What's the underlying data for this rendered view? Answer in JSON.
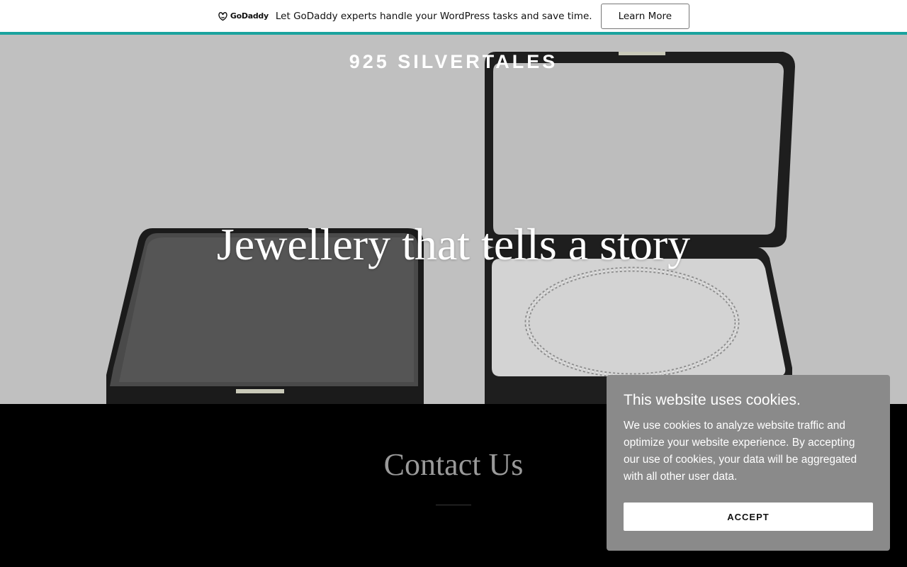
{
  "promo": {
    "logo_text": "GoDaddy",
    "message": "Let GoDaddy experts handle your WordPress tasks and save time.",
    "button_label": "Learn More",
    "accent_color": "#1aa39e"
  },
  "hero": {
    "brand": "925 SILVERTALES",
    "tagline": "Jewellery that tells a story"
  },
  "contact": {
    "title": "Contact Us"
  },
  "cookie": {
    "title": "This website uses cookies.",
    "body": "We use cookies to analyze website traffic and optimize your website experience. By accepting our use of cookies, your data will be aggregated with all other user data.",
    "accept_label": "ACCEPT"
  }
}
